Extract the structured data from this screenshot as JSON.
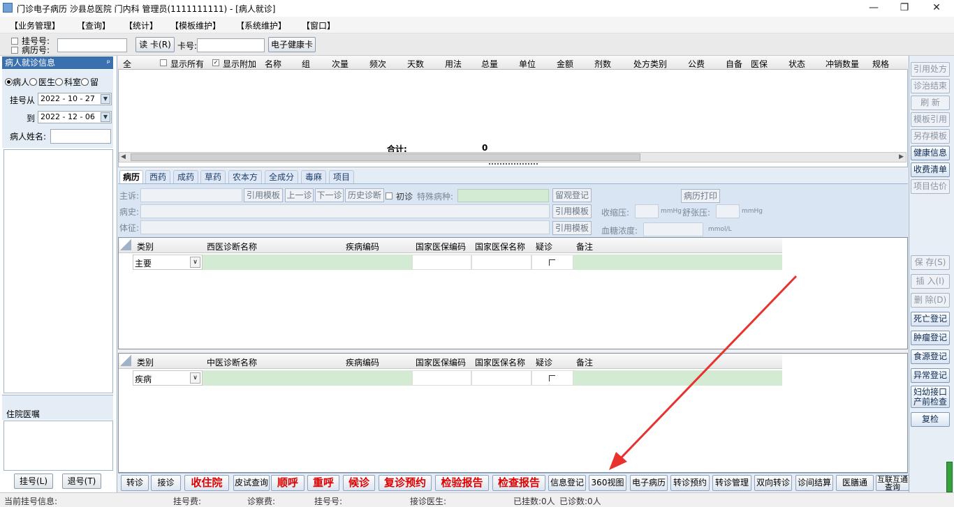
{
  "window": {
    "title": "门诊电子病历  沙县总医院  门内科  管理员(1111111111) - [病人就诊]",
    "controls": [
      "—",
      "❐",
      "✕"
    ]
  },
  "menu": [
    "【业务管理】",
    "【查询】",
    "【统计】",
    "【模板维护】",
    "【系统维护】",
    "【窗口】"
  ],
  "toolbar": {
    "reg_no_label": "挂号号:",
    "record_no_label": "病历号:",
    "read_card": "读 卡(R)",
    "card_no_label": "卡号:",
    "health_card": "电子健康卡"
  },
  "left_panel": {
    "header": "病人就诊信息",
    "pin": "ᵖ",
    "radios": [
      "病人",
      "医生",
      "科室",
      "留"
    ],
    "selected_radio": "病人",
    "date_from_label": "挂号从",
    "date_from": "2022 - 10 - 27",
    "date_to_label": "到",
    "date_to": "2022 - 12 - 06",
    "name_label": "病人姓名:",
    "inpatient_label": "住院医嘱",
    "register_btn": "挂号(L)",
    "unregister_btn": "退号(T)"
  },
  "rx_grid": {
    "select_all": "全",
    "show_all": "显示所有",
    "show_extra": "显示附加",
    "columns": [
      "名称",
      "组",
      "次量",
      "频次",
      "天数",
      "用法",
      "总量",
      "单位",
      "金额",
      "剂数",
      "处方类别",
      "公费",
      "自备",
      "医保",
      "状态",
      "冲销数量",
      "规格"
    ],
    "total_label": "合计:",
    "total_value": "0"
  },
  "tabs": [
    "病历",
    "西药",
    "成药",
    "草药",
    "农本方",
    "全成分",
    "毒麻",
    "项目"
  ],
  "active_tab": "病历",
  "form": {
    "complaint_label": "主诉:",
    "history_label": "病史:",
    "sign_label": "体征:",
    "cite_template": "引用模板",
    "prev_visit": "上一诊",
    "next_visit": "下一诊",
    "history_diag": "历史诊断",
    "first_visit": "初诊",
    "special_disease": "特殊病种:",
    "observe_register": "留观登记",
    "print_record": "病历打印",
    "systolic_label": "收缩压:",
    "diastolic_label": "舒张压:",
    "unit_mmhg": "mmHg",
    "glucose_label": "血糖浓度:",
    "unit_mmol": "mmol/L"
  },
  "west_diag": {
    "columns": [
      "类别",
      "西医诊断名称",
      "疾病编码",
      "国家医保编码",
      "国家医保名称",
      "疑诊",
      "备注"
    ],
    "row_type": "主要"
  },
  "tcm_diag": {
    "columns": [
      "类别",
      "中医诊断名称",
      "疾病编码",
      "国家医保编码",
      "国家医保名称",
      "疑诊",
      "备注"
    ],
    "row_type": "疾病"
  },
  "right_buttons": {
    "top": [
      "引用处方",
      "诊治结束",
      "刷 新",
      "模板引用",
      "另存模板",
      "健康信息",
      "收费清单",
      "项目估价"
    ],
    "top_enabled": [
      false,
      false,
      false,
      false,
      false,
      true,
      true,
      false
    ],
    "bottom": [
      "保 存(S)",
      "插 入(I)",
      "删 除(D)",
      "死亡登记",
      "肿瘤登记",
      "食源登记",
      "异常登记",
      "妇幼接口\n产前检查",
      "复检"
    ],
    "bottom_enabled": [
      false,
      false,
      false,
      true,
      true,
      true,
      true,
      true,
      true
    ]
  },
  "bottom_buttons": [
    {
      "label": "转诊",
      "red": false
    },
    {
      "label": "接诊",
      "red": false
    },
    {
      "label": "收住院",
      "red": true
    },
    {
      "label": "皮试查询",
      "red": false
    },
    {
      "label": "顺呼",
      "red": true
    },
    {
      "label": "重呼",
      "red": true
    },
    {
      "label": "候诊",
      "red": true
    },
    {
      "label": "复诊预约",
      "red": true
    },
    {
      "label": "检验报告",
      "red": true
    },
    {
      "label": "检查报告",
      "red": true
    },
    {
      "label": "信息登记",
      "red": false
    },
    {
      "label": "360视图",
      "red": false
    },
    {
      "label": "电子病历",
      "red": false
    },
    {
      "label": "转诊预约",
      "red": false
    },
    {
      "label": "转诊管理",
      "red": false
    },
    {
      "label": "双向转诊",
      "red": false
    },
    {
      "label": "诊间结算",
      "red": false
    },
    {
      "label": "医膳通",
      "red": false
    },
    {
      "label": "互联互通\n查询",
      "red": false
    }
  ],
  "status": {
    "current_reg": "当前挂号信息:",
    "reg_fee": "挂号费:",
    "diag_fee": "诊察费:",
    "reg_no": "挂号号:",
    "doctor": "接诊医生:",
    "registered": "已挂数:0人",
    "diagnosed": "已诊数:0人"
  },
  "colors": {
    "accent": "#3a6fb0",
    "red_button": "#e00000",
    "diag_fill": "#d3ebd3",
    "annotation_arrow": "#e8322e"
  }
}
